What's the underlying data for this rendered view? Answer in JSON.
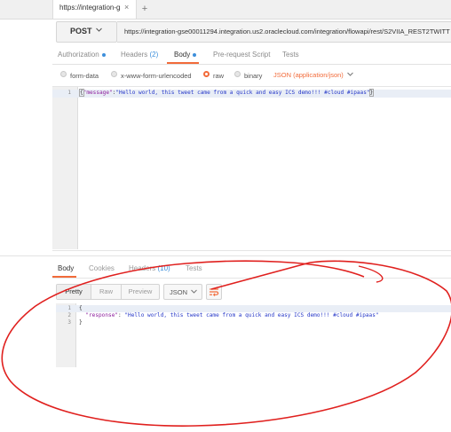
{
  "tab": {
    "label": "https://integration-gse",
    "close": "×",
    "new": "+"
  },
  "request": {
    "method": "POST",
    "url": "https://integration-gse00011294.integration.us2.oraclecloud.com/integration/flowapi/rest/S2VIIA_REST2TWITT",
    "tabs": {
      "authorization": "Authorization",
      "headers": "Headers",
      "headers_count": "(2)",
      "body": "Body",
      "pre_request": "Pre-request Script",
      "tests": "Tests"
    },
    "body_types": {
      "form_data": "form-data",
      "urlencoded": "x-www-form-urlencoded",
      "raw": "raw",
      "binary": "binary",
      "selected": "raw",
      "content_type": "JSON (application/json)"
    },
    "editor": {
      "line_number": "1",
      "key": "\"message\"",
      "value": "\"Hello world, this tweet came from a quick and easy ICS demo!!! #cloud #ipaas\""
    }
  },
  "response": {
    "tabs": {
      "body": "Body",
      "cookies": "Cookies",
      "headers": "Headers",
      "headers_count": "(10)",
      "tests": "Tests"
    },
    "toolbar": {
      "pretty": "Pretty",
      "raw": "Raw",
      "preview": "Preview",
      "format": "JSON",
      "wrap_icon": "wrap-lines-icon"
    },
    "editor": {
      "line_numbers": [
        "1",
        "2",
        "3"
      ],
      "open_brace": "{",
      "key": "\"response\"",
      "value": "\"Hello world, this tweet came from a quick and easy ICS demo!!! #cloud #ipaas\"",
      "close_brace": "}"
    }
  },
  "colors": {
    "accent": "#f26b3a",
    "link_blue": "#3d8fdb",
    "annotation_red": "#e0201e",
    "json_key": "#8b1c9c",
    "json_string": "#2436c8"
  }
}
